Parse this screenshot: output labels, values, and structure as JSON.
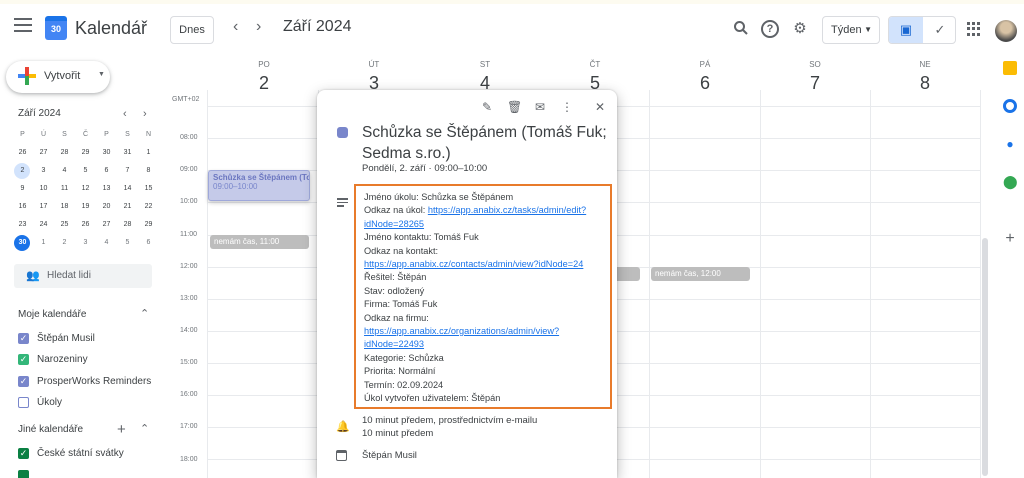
{
  "header": {
    "app_name": "Kalendář",
    "logo_text": "30",
    "today_label": "Dnes",
    "prev_icon": "‹",
    "next_icon": "›",
    "month_title": "Září 2024",
    "view_select": "Týden",
    "icons": [
      "menu-icon",
      "search-icon",
      "help-icon",
      "settings-icon",
      "calendar-view-icon",
      "tasks-view-icon",
      "apps-icon",
      "avatar"
    ]
  },
  "sidebar": {
    "create_label": "Vytvořit",
    "mini_title": "Září 2024",
    "mini_weekdays": [
      "P",
      "Ú",
      "S",
      "Č",
      "P",
      "S",
      "N"
    ],
    "mini_weeks": [
      [
        "26",
        "27",
        "28",
        "29",
        "30",
        "31",
        "1"
      ],
      [
        "2",
        "3",
        "4",
        "5",
        "6",
        "7",
        "8"
      ],
      [
        "9",
        "10",
        "11",
        "12",
        "13",
        "14",
        "15"
      ],
      [
        "16",
        "17",
        "18",
        "19",
        "20",
        "21",
        "22"
      ],
      [
        "23",
        "24",
        "25",
        "26",
        "27",
        "28",
        "29"
      ],
      [
        "30",
        "1",
        "2",
        "3",
        "4",
        "5",
        "6"
      ]
    ],
    "search_people": "Hledat lidi",
    "my_calendars_title": "Moje kalendáře",
    "my_calendars": [
      {
        "label": "Štěpán Musil",
        "color": "#7986cb",
        "checked": true
      },
      {
        "label": "Narozeniny",
        "color": "#33b679",
        "checked": true
      },
      {
        "label": "ProsperWorks Reminders",
        "color": "#7986cb",
        "checked": true
      },
      {
        "label": "Úkoly",
        "color": "#7986cb",
        "checked": false
      }
    ],
    "other_calendars_title": "Jiné kalendáře",
    "other_calendars": [
      {
        "label": "České státní svátky",
        "color": "#0b8043",
        "checked": true
      }
    ]
  },
  "grid": {
    "timezone": "GMT+02",
    "days": [
      {
        "name": "PO",
        "date": "2"
      },
      {
        "name": "ÚT",
        "date": "3"
      },
      {
        "name": "ST",
        "date": "4"
      },
      {
        "name": "ČT",
        "date": "5"
      },
      {
        "name": "PÁ",
        "date": "6"
      },
      {
        "name": "SO",
        "date": "7"
      },
      {
        "name": "NE",
        "date": "8"
      }
    ],
    "hours": [
      "08:00",
      "09:00",
      "10:00",
      "11:00",
      "12:00",
      "13:00",
      "14:00",
      "15:00",
      "16:00",
      "17:00",
      "18:00"
    ],
    "events": {
      "main_title": "Schůzka se Štěpánem (Tor",
      "main_time": "09:00–10:00",
      "busy_mon": "nemám čas, 11:00",
      "busy_fri": "nemám čas, 12:00"
    }
  },
  "popup": {
    "title": "Schůzka se Štěpánem (Tomáš Fuk; Sedma s.ro.)",
    "when": "Pondělí, 2. září  ·  09:00–10:00",
    "description": [
      {
        "text": "Jméno úkolu: Schůzka se Štěpánem",
        "link": false
      },
      {
        "text": "Odkaz na úkol: ",
        "link": false
      },
      {
        "text": "https://app.anabix.cz/tasks/admin/edit?",
        "link": true
      },
      {
        "text": "idNode=28265",
        "link": true
      },
      {
        "text": "Jméno kontaktu: Tomáš Fuk",
        "link": false
      },
      {
        "text": "Odkaz na kontakt:",
        "link": false
      },
      {
        "text": "https://app.anabix.cz/contacts/admin/view?idNode=24",
        "link": true
      },
      {
        "text": "Řešitel: Štěpán",
        "link": false
      },
      {
        "text": "Stav: odložený",
        "link": false
      },
      {
        "text": "Firma: Tomáš Fuk",
        "link": false
      },
      {
        "text": "Odkaz na firmu:",
        "link": false
      },
      {
        "text": "https://app.anabix.cz/organizations/admin/view?",
        "link": true
      },
      {
        "text": "idNode=22493",
        "link": true
      },
      {
        "text": "Kategorie: Schůzka",
        "link": false
      },
      {
        "text": "Priorita: Normální",
        "link": false
      },
      {
        "text": "Termín: 02.09.2024",
        "link": false
      },
      {
        "text": "Úkol vytvořen uživatelem: Štěpán",
        "link": false
      }
    ],
    "reminder_1": "10 minut předem, prostřednictvím e-mailu",
    "reminder_2": "10 minut předem",
    "owner": "Štěpán Musil",
    "highlight_color": "#e87b2b"
  }
}
